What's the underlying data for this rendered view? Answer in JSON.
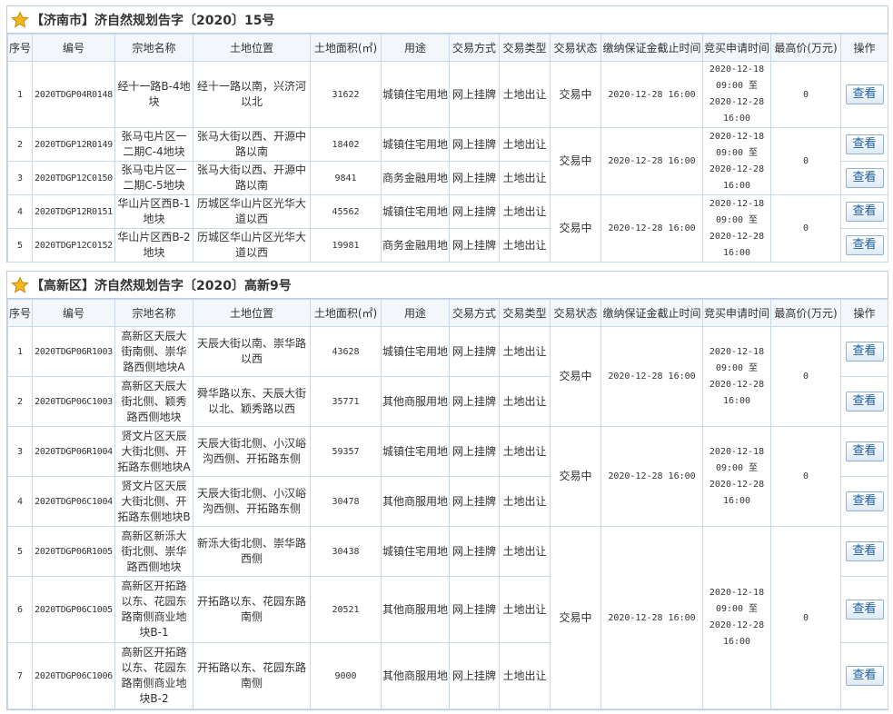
{
  "panels": [
    {
      "title": "【济南市】济自然规划告字〔2020〕15号",
      "headers": [
        "序号",
        "编号",
        "宗地名称",
        "土地位置",
        "土地面积(㎡)",
        "用途",
        "交易方式",
        "交易类型",
        "交易状态",
        "缴纳保证金截止时间",
        "竞买申请时间",
        "最高价(万元)",
        "操作"
      ],
      "rows": [
        {
          "seq": "1",
          "code": "2020TDGP04R0148",
          "name": "经十一路B-4地块",
          "location": "经十一路以南，兴济河以北",
          "area": "31622",
          "use": "城镇住宅用地",
          "method": "网上挂牌",
          "type": "土地出让"
        },
        {
          "seq": "2",
          "code": "2020TDGP12R0149",
          "name": "张马屯片区一二期C-4地块",
          "location": "张马大街以西、开源中路以南",
          "area": "18402",
          "use": "城镇住宅用地",
          "method": "网上挂牌",
          "type": "土地出让"
        },
        {
          "seq": "3",
          "code": "2020TDGP12C0150",
          "name": "张马屯片区一二期C-5地块",
          "location": "张马大街以西、开源中路以南",
          "area": "9841",
          "use": "商务金融用地",
          "method": "网上挂牌",
          "type": "土地出让"
        },
        {
          "seq": "4",
          "code": "2020TDGP12R0151",
          "name": "华山片区西B-1地块",
          "location": "历城区华山片区光华大道以西",
          "area": "45562",
          "use": "城镇住宅用地",
          "method": "网上挂牌",
          "type": "土地出让"
        },
        {
          "seq": "5",
          "code": "2020TDGP12C0152",
          "name": "华山片区西B-2地块",
          "location": "历城区华山片区光华大道以西",
          "area": "19981",
          "use": "商务金融用地",
          "method": "网上挂牌",
          "type": "土地出让"
        }
      ],
      "groups": [
        {
          "start": 0,
          "span": 1,
          "status": "交易中",
          "deadline": "2020-12-28 16:00",
          "apply": [
            "2020-12-18",
            "09:00 至",
            "2020-12-28",
            "16:00"
          ],
          "price": "0"
        },
        {
          "start": 1,
          "span": 2,
          "status": "交易中",
          "deadline": "2020-12-28 16:00",
          "apply": [
            "2020-12-18",
            "09:00 至",
            "2020-12-28",
            "16:00"
          ],
          "price": "0"
        },
        {
          "start": 3,
          "span": 2,
          "status": "交易中",
          "deadline": "2020-12-28 16:00",
          "apply": [
            "2020-12-18",
            "09:00 至",
            "2020-12-28",
            "16:00"
          ],
          "price": "0"
        }
      ],
      "view_label": "查看"
    },
    {
      "title": "【高新区】济自然规划告字〔2020〕高新9号",
      "headers": [
        "序号",
        "编号",
        "宗地名称",
        "土地位置",
        "土地面积(㎡)",
        "用途",
        "交易方式",
        "交易类型",
        "交易状态",
        "缴纳保证金截止时间",
        "竞买申请时间",
        "最高价(万元)",
        "操作"
      ],
      "rows": [
        {
          "seq": "1",
          "code": "2020TDGP06R1003",
          "name": "高新区天辰大街南侧、崇华路西侧地块A",
          "location": "天辰大街以南、崇华路以西",
          "area": "43628",
          "use": "城镇住宅用地",
          "method": "网上挂牌",
          "type": "土地出让"
        },
        {
          "seq": "2",
          "code": "2020TDGP06C1003",
          "name": "高新区天辰大街北侧、颖秀路西侧地块",
          "location": "舜华路以东、天辰大街以北、颖秀路以西",
          "area": "35771",
          "use": "其他商服用地",
          "method": "网上挂牌",
          "type": "土地出让"
        },
        {
          "seq": "3",
          "code": "2020TDGP06R1004",
          "name": "贤文片区天辰大街北侧、开拓路东侧地块A",
          "location": "天辰大街北侧、小汉峪沟西侧、开拓路东侧",
          "area": "59357",
          "use": "城镇住宅用地",
          "method": "网上挂牌",
          "type": "土地出让"
        },
        {
          "seq": "4",
          "code": "2020TDGP06C1004",
          "name": "贤文片区天辰大街北侧、开拓路东侧地块B",
          "location": "天辰大街北侧、小汉峪沟西侧、开拓路东侧",
          "area": "30478",
          "use": "其他商服用地",
          "method": "网上挂牌",
          "type": "土地出让"
        },
        {
          "seq": "5",
          "code": "2020TDGP06R1005",
          "name": "高新区新泺大街北侧、崇华路西侧地块",
          "location": "新泺大街北侧、崇华路西侧",
          "area": "30438",
          "use": "城镇住宅用地",
          "method": "网上挂牌",
          "type": "土地出让"
        },
        {
          "seq": "6",
          "code": "2020TDGP06C1005",
          "name": "高新区开拓路以东、花园东路南侧商业地块B-1",
          "location": "开拓路以东、花园东路南侧",
          "area": "20521",
          "use": "其他商服用地",
          "method": "网上挂牌",
          "type": "土地出让"
        },
        {
          "seq": "7",
          "code": "2020TDGP06C1006",
          "name": "高新区开拓路以东、花园东路南侧商业地块B-2",
          "location": "开拓路以东、花园东路南侧",
          "area": "9000",
          "use": "其他商服用地",
          "method": "网上挂牌",
          "type": "土地出让"
        }
      ],
      "groups": [
        {
          "start": 0,
          "span": 2,
          "status": "交易中",
          "deadline": "2020-12-28 16:00",
          "apply": [
            "2020-12-18",
            "09:00 至",
            "2020-12-28",
            "16:00"
          ],
          "price": "0"
        },
        {
          "start": 2,
          "span": 2,
          "status": "交易中",
          "deadline": "2020-12-28 16:00",
          "apply": [
            "2020-12-18",
            "09:00 至",
            "2020-12-28",
            "16:00"
          ],
          "price": "0"
        },
        {
          "start": 4,
          "span": 3,
          "status": "交易中",
          "deadline": "2020-12-28 16:00",
          "apply": [
            "2020-12-18",
            "09:00 至",
            "2020-12-28",
            "16:00"
          ],
          "price": "0"
        }
      ],
      "view_label": "查看"
    }
  ],
  "icons": {
    "panel_icon": "star-icon"
  },
  "colors": {
    "border": "#b8cfe4",
    "header_bg": "#f3f7fb",
    "button_text": "#1b5ea3",
    "star": "#f3b81f"
  }
}
